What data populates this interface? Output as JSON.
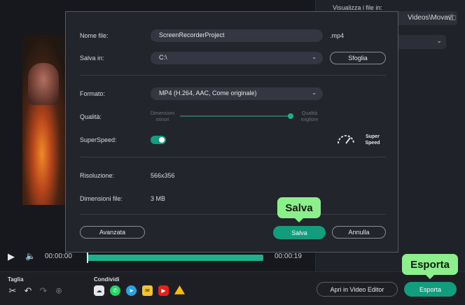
{
  "background": {
    "output_folder_label": "Visualizza i file in:",
    "output_folder_path": "Videos\\Movavi",
    "player": {
      "time_current": "00:00:00",
      "time_total": "00:00:19"
    },
    "bottom_bar": {
      "cut_label": "Taglia",
      "share_label": "Condividi",
      "open_in_editor": "Apri in Video Editor",
      "export": "Esporta"
    }
  },
  "dialog": {
    "file_name_label": "Nome file:",
    "file_name_value": "ScreenRecorderProject",
    "file_extension": ".mp4",
    "save_in_label": "Salva in:",
    "save_in_value": "C:\\",
    "browse_button": "Sfoglia",
    "format_label": "Formato:",
    "format_value": "MP4 (H.264, AAC, Come originale)",
    "quality_label": "Qualità:",
    "quality_min": "Dimensioni minori",
    "quality_max": "Qualità migliore",
    "quality_level": 0.97,
    "superspeed_label": "SuperSpeed:",
    "superspeed_on": true,
    "superspeed_badge": "Super Speed",
    "resolution_label": "Risoluzione:",
    "resolution_value": "566x356",
    "filesize_label": "Dimensioni file:",
    "filesize_value": "3 MB",
    "advanced_button": "Avanzata",
    "save_button": "Salva",
    "cancel_button": "Annulla"
  },
  "callouts": {
    "save": "Salva",
    "export": "Esporta"
  },
  "colors": {
    "accent": "#129e7e",
    "callout": "#8bf08b",
    "dialog_bg": "#23252d",
    "app_bg": "#17181d"
  }
}
